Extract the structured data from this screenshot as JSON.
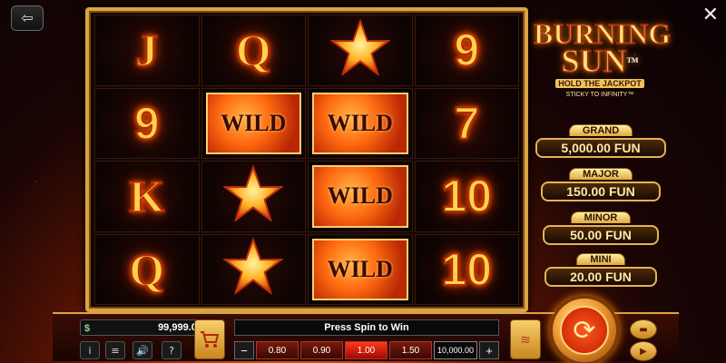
{
  "header": {
    "exit_icon": "exit-icon",
    "close_icon": "close-icon",
    "close_glyph": "✕",
    "exit_glyph": "⇦"
  },
  "logo": {
    "line1": "BURNING",
    "line2": "SUN",
    "tm": "TM",
    "tagline": "HOLD THE JACKPOT",
    "tagline2": "STICKY TO INFINITY™"
  },
  "reels": [
    [
      {
        "type": "letter",
        "value": "J"
      },
      {
        "type": "letter",
        "value": "Q"
      },
      {
        "type": "star"
      },
      {
        "type": "number",
        "value": "9"
      }
    ],
    [
      {
        "type": "number",
        "value": "9"
      },
      {
        "type": "wild",
        "value": "WILD"
      },
      {
        "type": "wild",
        "value": "WILD"
      },
      {
        "type": "number",
        "value": "7"
      }
    ],
    [
      {
        "type": "letter",
        "value": "K"
      },
      {
        "type": "star"
      },
      {
        "type": "wild",
        "value": "WILD"
      },
      {
        "type": "number",
        "value": "10"
      }
    ],
    [
      {
        "type": "letter",
        "value": "Q"
      },
      {
        "type": "star"
      },
      {
        "type": "wild",
        "value": "WILD"
      },
      {
        "type": "number",
        "value": "10"
      }
    ]
  ],
  "jackpots": [
    {
      "label": "GRAND",
      "value": "5,000.00 FUN"
    },
    {
      "label": "MAJOR",
      "value": "150.00 FUN"
    },
    {
      "label": "MINOR",
      "value": "50.00 FUN"
    },
    {
      "label": "MINI",
      "value": "20.00 FUN"
    }
  ],
  "controls": {
    "balance": "99,999.00",
    "message": "Press Spin to Win",
    "minus": "−",
    "plus": "+",
    "bets": [
      "0.80",
      "0.90",
      "1.00",
      "1.50"
    ],
    "selected_bet": "1.00",
    "total_bet": "10,000.00",
    "info_glyph": "i",
    "menu_glyph": "≡",
    "sound_glyph": "🔊",
    "help_glyph": "?",
    "spin_glyph": "⟳"
  },
  "colors": {
    "accent_gold": "#d9a441",
    "fire": "#ff6a00"
  }
}
